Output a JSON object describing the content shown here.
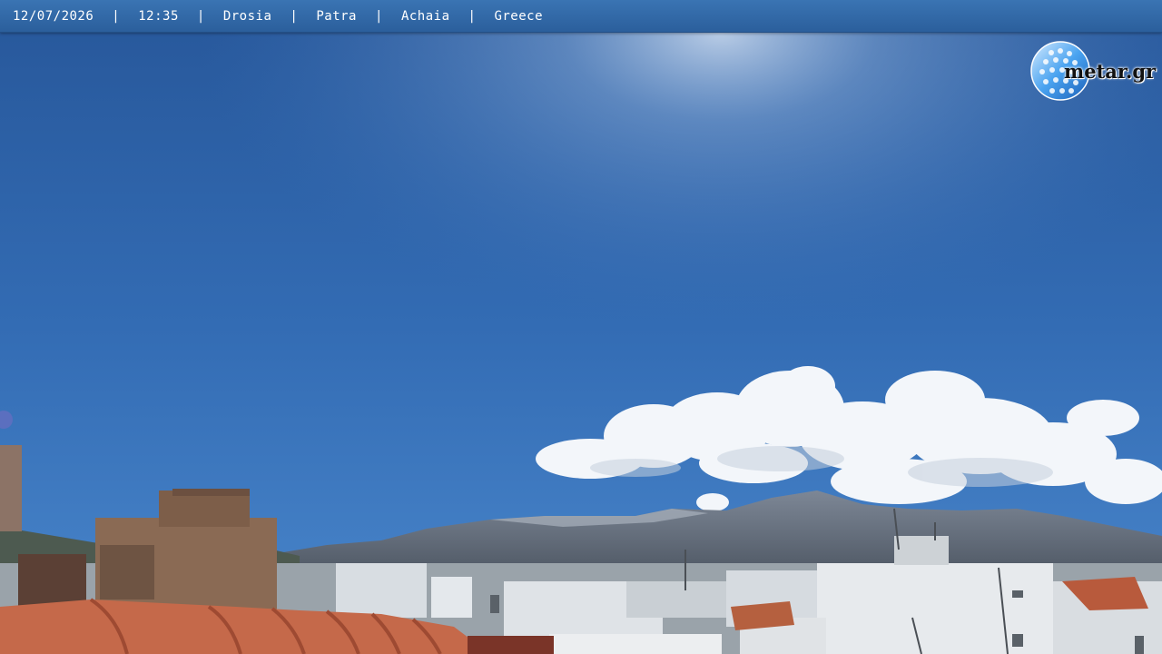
{
  "overlay": {
    "date": "12/07/2026",
    "time": "12:35",
    "location": "Drosia",
    "city": "Patra",
    "region": "Achaia",
    "country": "Greece",
    "separator": "|"
  },
  "logo": {
    "text": "metar.gr",
    "icon": "globe-icon"
  },
  "colors": {
    "bar": "#2f68a8",
    "sky_top": "#2a5ea0",
    "sky_bottom": "#4a8ad0"
  }
}
